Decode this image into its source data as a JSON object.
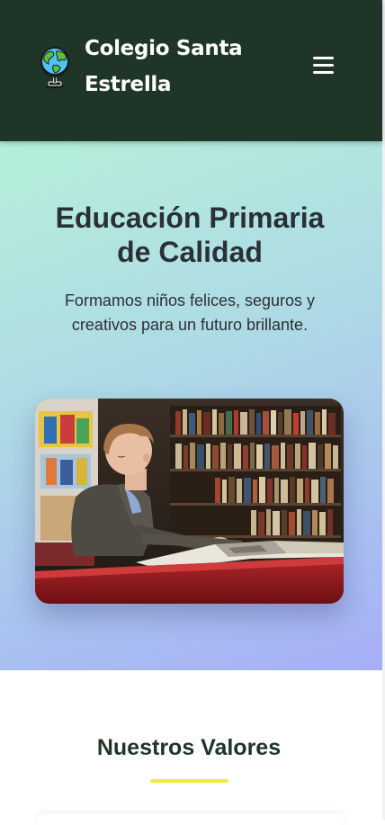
{
  "header": {
    "brand_line1": "Colegio Santa",
    "brand_line2": "Estrella",
    "logo_icon": "globe-icon",
    "menu_icon": "hamburger-menu-icon"
  },
  "hero": {
    "title_line1": "Educación Primaria",
    "title_line2": "de Calidad",
    "subtitle_line1": "Formamos niños felices, seguros y",
    "subtitle_line2": "creativos para un futuro brillante.",
    "image_subject": "child-reading-in-library"
  },
  "values": {
    "title": "Nuestros Valores"
  },
  "colors": {
    "header_bg": "#1e3528",
    "accent_yellow": "#f1ea3f",
    "hero_gradient_start": "#b5f0da",
    "hero_gradient_end": "#a6aef7",
    "heading_dark": "#2b3038"
  }
}
